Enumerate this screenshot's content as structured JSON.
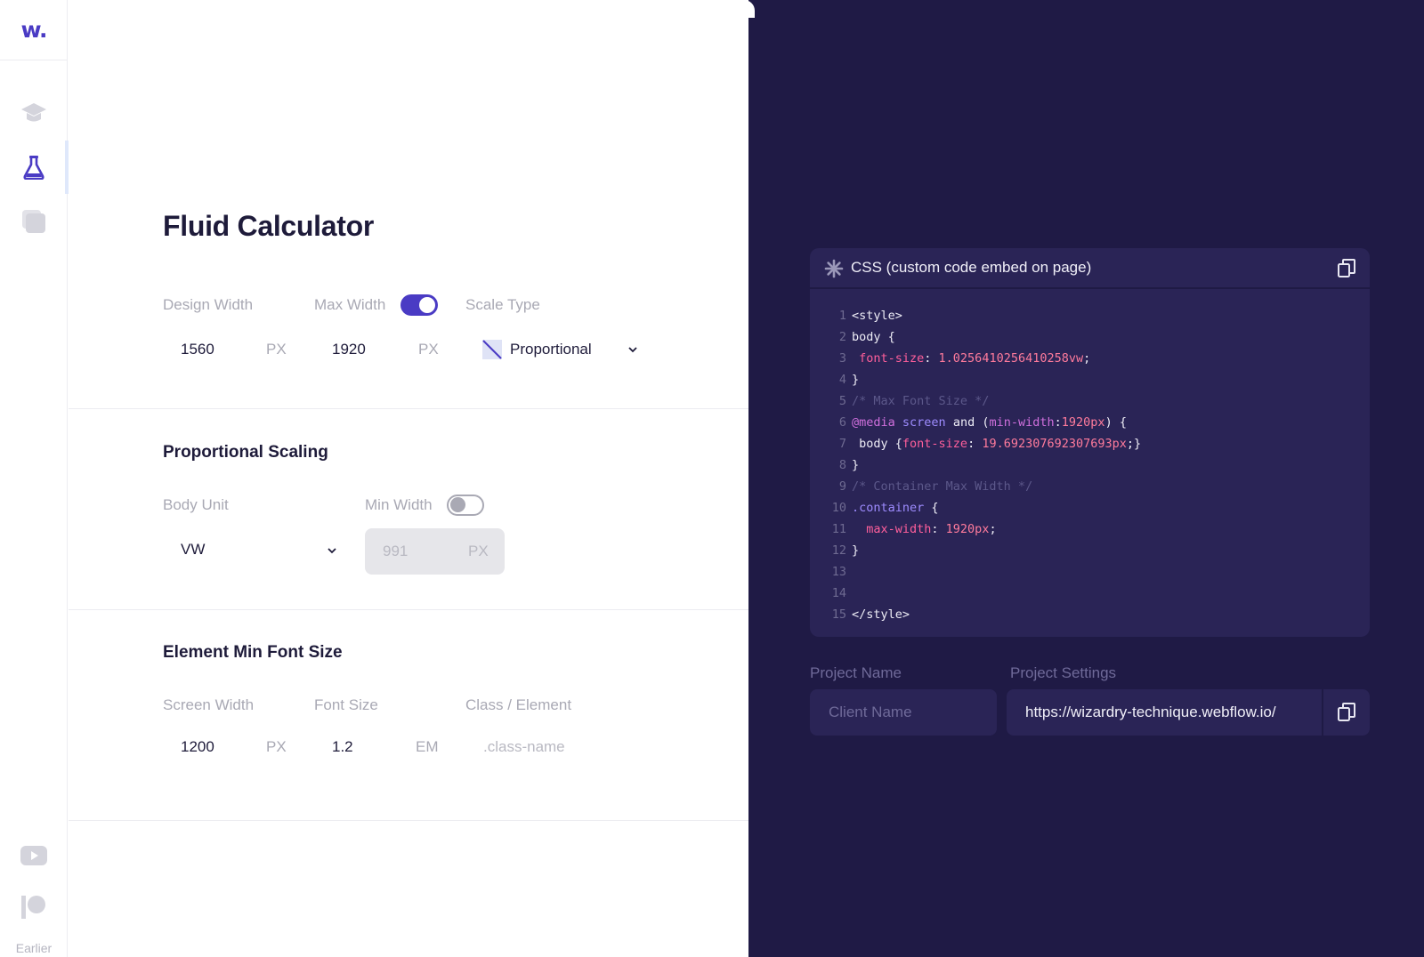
{
  "sidebar": {
    "logo": "w.",
    "nav": [
      {
        "icon": "graduation-cap-icon"
      },
      {
        "icon": "flask-icon",
        "active": true
      },
      {
        "icon": "stack-icon"
      }
    ],
    "footer_icons": [
      "youtube-icon",
      "patreon-icon"
    ],
    "earlier_label": "Earlier"
  },
  "header": {
    "title": "Fluid Calculator"
  },
  "calc": {
    "design_width_label": "Design Width",
    "design_width_value": "1560",
    "design_width_unit": "PX",
    "max_width_label": "Max Width",
    "max_width_toggle": true,
    "max_width_value": "1920",
    "max_width_unit": "PX",
    "scale_type_label": "Scale Type",
    "scale_type_value": "Proportional"
  },
  "proportional": {
    "title": "Proportional Scaling",
    "body_unit_label": "Body Unit",
    "body_unit_value": "VW",
    "min_width_label": "Min Width",
    "min_width_toggle": false,
    "min_width_value": "991",
    "min_width_unit": "PX"
  },
  "element_min": {
    "title": "Element Min Font Size",
    "screen_width_label": "Screen Width",
    "screen_width_value": "1200",
    "screen_width_unit": "PX",
    "font_size_label": "Font Size",
    "font_size_value": "1.2",
    "font_size_unit": "EM",
    "class_label": "Class / Element",
    "class_placeholder": ".class-name"
  },
  "code": {
    "title": "CSS (custom code embed on page)",
    "lines": [
      {
        "n": "1",
        "parts": [
          {
            "t": "<style>",
            "c": ""
          }
        ]
      },
      {
        "n": "2",
        "parts": [
          {
            "t": "body {",
            "c": ""
          }
        ]
      },
      {
        "n": "3",
        "parts": [
          {
            "t": " font-size",
            "c": "c-prop"
          },
          {
            "t": ": ",
            "c": ""
          },
          {
            "t": "1.0256410256410258vw",
            "c": "c-num"
          },
          {
            "t": ";",
            "c": ""
          }
        ]
      },
      {
        "n": "4",
        "parts": [
          {
            "t": "}",
            "c": ""
          }
        ]
      },
      {
        "n": "5",
        "parts": [
          {
            "t": "/* Max Font Size */",
            "c": "c-cmt"
          }
        ]
      },
      {
        "n": "6",
        "parts": [
          {
            "t": "@media",
            "c": "c-kw"
          },
          {
            "t": " ",
            "c": ""
          },
          {
            "t": "screen",
            "c": "c-sel"
          },
          {
            "t": " and (",
            "c": ""
          },
          {
            "t": "min-width",
            "c": "c-kw"
          },
          {
            "t": ":",
            "c": ""
          },
          {
            "t": "1920px",
            "c": "c-num"
          },
          {
            "t": ") {",
            "c": ""
          }
        ]
      },
      {
        "n": "7",
        "parts": [
          {
            "t": " body {",
            "c": ""
          },
          {
            "t": "font-size",
            "c": "c-prop"
          },
          {
            "t": ": ",
            "c": ""
          },
          {
            "t": "19.692307692307693px",
            "c": "c-num"
          },
          {
            "t": ";}",
            "c": ""
          }
        ]
      },
      {
        "n": "8",
        "parts": [
          {
            "t": "}",
            "c": ""
          }
        ]
      },
      {
        "n": "9",
        "parts": [
          {
            "t": "/* Container Max Width */",
            "c": "c-cmt"
          }
        ]
      },
      {
        "n": "10",
        "parts": [
          {
            "t": ".container",
            "c": "c-sel"
          },
          {
            "t": " {",
            "c": ""
          }
        ]
      },
      {
        "n": "11",
        "parts": [
          {
            "t": "  max-width",
            "c": "c-prop"
          },
          {
            "t": ": ",
            "c": ""
          },
          {
            "t": "1920px",
            "c": "c-num"
          },
          {
            "t": ";",
            "c": ""
          }
        ]
      },
      {
        "n": "12",
        "parts": [
          {
            "t": "}",
            "c": ""
          }
        ]
      },
      {
        "n": "13",
        "parts": []
      },
      {
        "n": "14",
        "parts": []
      },
      {
        "n": "15",
        "parts": [
          {
            "t": "</style>",
            "c": ""
          }
        ]
      }
    ]
  },
  "project": {
    "name_label": "Project Name",
    "name_placeholder": "Client Name",
    "settings_label": "Project Settings",
    "settings_value": "https://wizardry-technique.webflow.io/"
  },
  "colors": {
    "accent": "#4a3bc4",
    "dark_bg": "#1f1a45",
    "card_bg": "#2a2456"
  }
}
